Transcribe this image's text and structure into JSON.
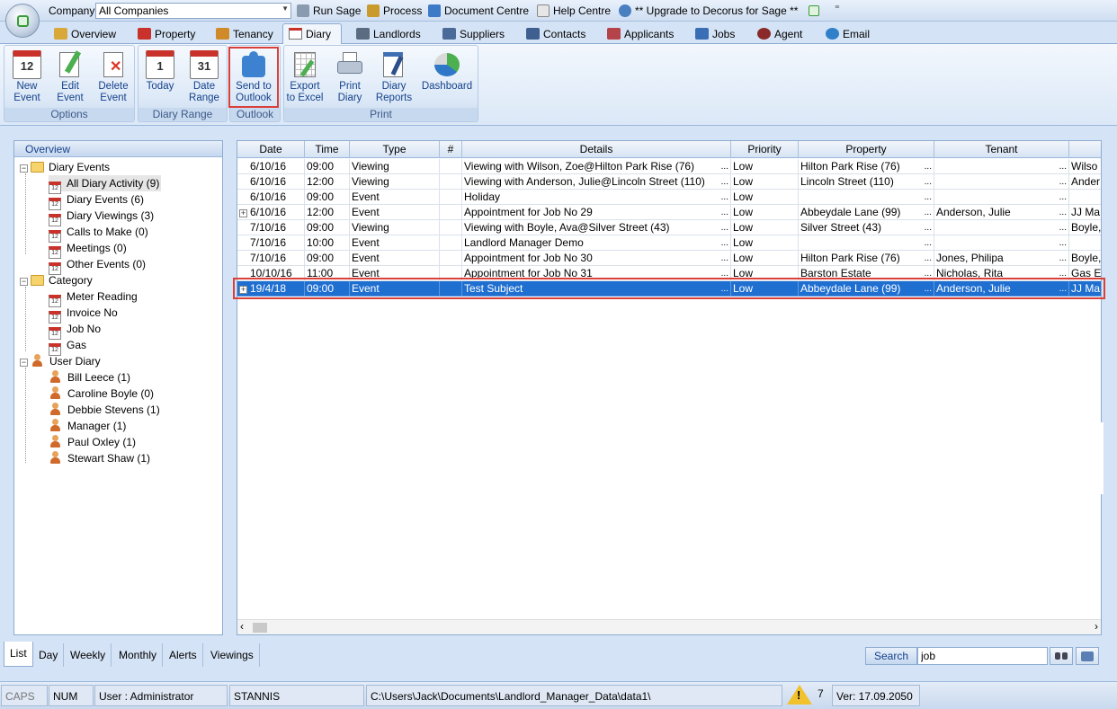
{
  "topbar": {
    "company_label": "Company",
    "company_value": "All Companies",
    "actions": [
      "Run Sage",
      "Process",
      "Document Centre",
      "Help Centre",
      "** Upgrade to Decorus for Sage **"
    ]
  },
  "tabs": [
    "Overview",
    "Property",
    "Tenancy",
    "Diary",
    "Landlords",
    "Suppliers",
    "Contacts",
    "Applicants",
    "Jobs",
    "Agent",
    "Email"
  ],
  "ribbon": {
    "groups": [
      "Options",
      "Diary Range",
      "Outlook",
      "Print"
    ],
    "buttons": {
      "new_event": [
        "New",
        "Event"
      ],
      "edit_event": [
        "Edit",
        "Event"
      ],
      "delete_event": [
        "Delete",
        "Event"
      ],
      "today": [
        "Today",
        ""
      ],
      "date_range": [
        "Date",
        "Range"
      ],
      "send_outlook": [
        "Send to",
        "Outlook"
      ],
      "export_excel": [
        "Export",
        "to Excel"
      ],
      "print_diary": [
        "Print",
        "Diary"
      ],
      "diary_reports": [
        "Diary",
        "Reports"
      ],
      "dashboard": [
        "Dashboard",
        ""
      ]
    },
    "cal_today": "1",
    "cal_new": "12",
    "cal_range": "31"
  },
  "tree": {
    "header": "Overview",
    "diary_events": "Diary Events",
    "diary_items": [
      "All Diary Activity (9)",
      "Diary Events (6)",
      "Diary Viewings (3)",
      "Calls to Make (0)",
      "Meetings (0)",
      "Other Events (0)"
    ],
    "category": "Category",
    "category_items": [
      "Meter Reading",
      "Invoice No",
      "Job No",
      "Gas"
    ],
    "user_diary": "User Diary",
    "user_items": [
      "Bill Leece (1)",
      "Caroline Boyle (0)",
      "Debbie Stevens (1)",
      "Manager (1)",
      "Paul Oxley (1)",
      "Stewart Shaw (1)"
    ]
  },
  "grid": {
    "columns": [
      "Date",
      "Time",
      "Type",
      "#",
      "Details",
      "Priority",
      "Property",
      "Tenant",
      ""
    ],
    "rows": [
      [
        "6/10/16",
        "09:00",
        "Viewing",
        "",
        "Viewing with Wilson, Zoe@Hilton Park Rise (76)",
        "Low",
        "Hilton Park Rise (76)",
        "",
        "Wilso"
      ],
      [
        "6/10/16",
        "12:00",
        "Viewing",
        "",
        "Viewing with Anderson, Julie@Lincoln Street (110)",
        "Low",
        "Lincoln Street (110)",
        "",
        "Ander"
      ],
      [
        "6/10/16",
        "09:00",
        "Event",
        "",
        "Holiday",
        "Low",
        "",
        "",
        ""
      ],
      [
        "6/10/16",
        "12:00",
        "Event",
        "",
        "Appointment for Job No 29",
        "Low",
        "Abbeydale Lane (99)",
        "Anderson, Julie",
        "JJ Ma"
      ],
      [
        "7/10/16",
        "09:00",
        "Viewing",
        "",
        "Viewing with Boyle, Ava@Silver Street (43)",
        "Low",
        "Silver Street (43)",
        "",
        "Boyle,"
      ],
      [
        "7/10/16",
        "10:00",
        "Event",
        "",
        "Landlord Manager Demo",
        "Low",
        "",
        "",
        ""
      ],
      [
        "7/10/16",
        "09:00",
        "Event",
        "",
        "Appointment for Job No 30",
        "Low",
        "Hilton Park Rise (76)",
        "Jones, Philipa",
        "Boyle,"
      ],
      [
        "10/10/16",
        "11:00",
        "Event",
        "",
        "Appointment for Job No 31",
        "Low",
        "Barston Estate",
        "Nicholas, Rita",
        "Gas E"
      ],
      [
        "19/4/18",
        "09:00",
        "Event",
        "",
        "Test Subject",
        "Low",
        "Abbeydale Lane (99)",
        "Anderson, Julie",
        "JJ Ma"
      ]
    ],
    "expand_rows": [
      3,
      8
    ],
    "selected_row": 8
  },
  "bottom_tabs": [
    "List",
    "Day",
    "Weekly",
    "Monthly",
    "Alerts",
    "Viewings"
  ],
  "search": {
    "label": "Search",
    "value": "job"
  },
  "status": {
    "caps": "CAPS",
    "num": "NUM",
    "user": "User : Administrator",
    "machine": "STANNIS",
    "path": "C:\\Users\\Jack\\Documents\\Landlord_Manager_Data\\data1\\",
    "warnings": "7",
    "version": "Ver: 17.09.2050"
  },
  "colors": {
    "accent": "#15428b",
    "selection": "#1f6fd1",
    "highlight": "#d9403a"
  }
}
